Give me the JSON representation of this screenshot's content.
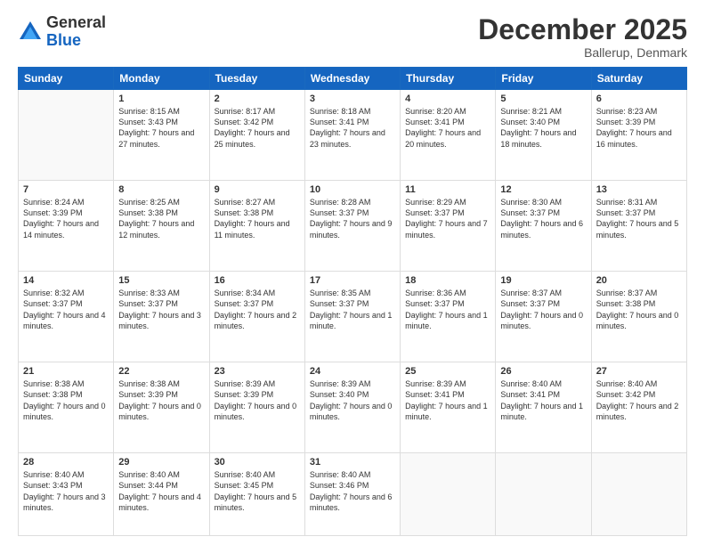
{
  "logo": {
    "general": "General",
    "blue": "Blue"
  },
  "header": {
    "month": "December 2025",
    "location": "Ballerup, Denmark"
  },
  "days": [
    "Sunday",
    "Monday",
    "Tuesday",
    "Wednesday",
    "Thursday",
    "Friday",
    "Saturday"
  ],
  "weeks": [
    [
      {
        "num": "",
        "content": ""
      },
      {
        "num": "1",
        "content": "Sunrise: 8:15 AM\nSunset: 3:43 PM\nDaylight: 7 hours\nand 27 minutes."
      },
      {
        "num": "2",
        "content": "Sunrise: 8:17 AM\nSunset: 3:42 PM\nDaylight: 7 hours\nand 25 minutes."
      },
      {
        "num": "3",
        "content": "Sunrise: 8:18 AM\nSunset: 3:41 PM\nDaylight: 7 hours\nand 23 minutes."
      },
      {
        "num": "4",
        "content": "Sunrise: 8:20 AM\nSunset: 3:41 PM\nDaylight: 7 hours\nand 20 minutes."
      },
      {
        "num": "5",
        "content": "Sunrise: 8:21 AM\nSunset: 3:40 PM\nDaylight: 7 hours\nand 18 minutes."
      },
      {
        "num": "6",
        "content": "Sunrise: 8:23 AM\nSunset: 3:39 PM\nDaylight: 7 hours\nand 16 minutes."
      }
    ],
    [
      {
        "num": "7",
        "content": "Sunrise: 8:24 AM\nSunset: 3:39 PM\nDaylight: 7 hours\nand 14 minutes."
      },
      {
        "num": "8",
        "content": "Sunrise: 8:25 AM\nSunset: 3:38 PM\nDaylight: 7 hours\nand 12 minutes."
      },
      {
        "num": "9",
        "content": "Sunrise: 8:27 AM\nSunset: 3:38 PM\nDaylight: 7 hours\nand 11 minutes."
      },
      {
        "num": "10",
        "content": "Sunrise: 8:28 AM\nSunset: 3:37 PM\nDaylight: 7 hours\nand 9 minutes."
      },
      {
        "num": "11",
        "content": "Sunrise: 8:29 AM\nSunset: 3:37 PM\nDaylight: 7 hours\nand 7 minutes."
      },
      {
        "num": "12",
        "content": "Sunrise: 8:30 AM\nSunset: 3:37 PM\nDaylight: 7 hours\nand 6 minutes."
      },
      {
        "num": "13",
        "content": "Sunrise: 8:31 AM\nSunset: 3:37 PM\nDaylight: 7 hours\nand 5 minutes."
      }
    ],
    [
      {
        "num": "14",
        "content": "Sunrise: 8:32 AM\nSunset: 3:37 PM\nDaylight: 7 hours\nand 4 minutes."
      },
      {
        "num": "15",
        "content": "Sunrise: 8:33 AM\nSunset: 3:37 PM\nDaylight: 7 hours\nand 3 minutes."
      },
      {
        "num": "16",
        "content": "Sunrise: 8:34 AM\nSunset: 3:37 PM\nDaylight: 7 hours\nand 2 minutes."
      },
      {
        "num": "17",
        "content": "Sunrise: 8:35 AM\nSunset: 3:37 PM\nDaylight: 7 hours\nand 1 minute."
      },
      {
        "num": "18",
        "content": "Sunrise: 8:36 AM\nSunset: 3:37 PM\nDaylight: 7 hours\nand 1 minute."
      },
      {
        "num": "19",
        "content": "Sunrise: 8:37 AM\nSunset: 3:37 PM\nDaylight: 7 hours\nand 0 minutes."
      },
      {
        "num": "20",
        "content": "Sunrise: 8:37 AM\nSunset: 3:38 PM\nDaylight: 7 hours\nand 0 minutes."
      }
    ],
    [
      {
        "num": "21",
        "content": "Sunrise: 8:38 AM\nSunset: 3:38 PM\nDaylight: 7 hours\nand 0 minutes."
      },
      {
        "num": "22",
        "content": "Sunrise: 8:38 AM\nSunset: 3:39 PM\nDaylight: 7 hours\nand 0 minutes."
      },
      {
        "num": "23",
        "content": "Sunrise: 8:39 AM\nSunset: 3:39 PM\nDaylight: 7 hours\nand 0 minutes."
      },
      {
        "num": "24",
        "content": "Sunrise: 8:39 AM\nSunset: 3:40 PM\nDaylight: 7 hours\nand 0 minutes."
      },
      {
        "num": "25",
        "content": "Sunrise: 8:39 AM\nSunset: 3:41 PM\nDaylight: 7 hours\nand 1 minute."
      },
      {
        "num": "26",
        "content": "Sunrise: 8:40 AM\nSunset: 3:41 PM\nDaylight: 7 hours\nand 1 minute."
      },
      {
        "num": "27",
        "content": "Sunrise: 8:40 AM\nSunset: 3:42 PM\nDaylight: 7 hours\nand 2 minutes."
      }
    ],
    [
      {
        "num": "28",
        "content": "Sunrise: 8:40 AM\nSunset: 3:43 PM\nDaylight: 7 hours\nand 3 minutes."
      },
      {
        "num": "29",
        "content": "Sunrise: 8:40 AM\nSunset: 3:44 PM\nDaylight: 7 hours\nand 4 minutes."
      },
      {
        "num": "30",
        "content": "Sunrise: 8:40 AM\nSunset: 3:45 PM\nDaylight: 7 hours\nand 5 minutes."
      },
      {
        "num": "31",
        "content": "Sunrise: 8:40 AM\nSunset: 3:46 PM\nDaylight: 7 hours\nand 6 minutes."
      },
      {
        "num": "",
        "content": ""
      },
      {
        "num": "",
        "content": ""
      },
      {
        "num": "",
        "content": ""
      }
    ]
  ]
}
